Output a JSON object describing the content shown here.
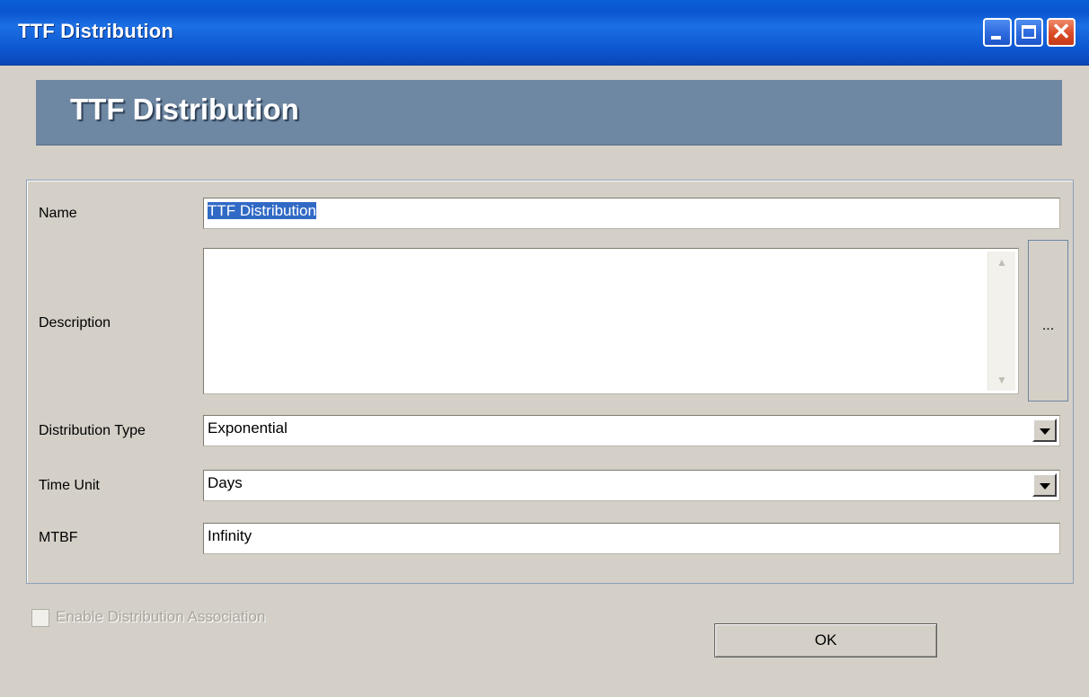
{
  "window": {
    "title": "TTF Distribution",
    "controls": {
      "minimize": "minimize-icon",
      "maximize": "maximize-icon",
      "close": "close-icon"
    }
  },
  "header": {
    "title": "TTF Distribution"
  },
  "form": {
    "name": {
      "label": "Name",
      "value": "TTF Distribution"
    },
    "description": {
      "label": "Description",
      "value": "",
      "expand_label": "..."
    },
    "distribution_type": {
      "label": "Distribution Type",
      "value": "Exponential"
    },
    "time_unit": {
      "label": "Time Unit",
      "value": "Days"
    },
    "mtbf": {
      "label": "MTBF",
      "value": "Infinity"
    }
  },
  "enable_association": {
    "label": "Enable Distribution Association",
    "checked": false,
    "enabled": false
  },
  "ok_button": {
    "label": "OK"
  },
  "colors": {
    "titlebar": "#0a55d0",
    "banner": "#6e87a2",
    "dialog_bg": "#d4d0c8",
    "selection": "#316ac5"
  }
}
